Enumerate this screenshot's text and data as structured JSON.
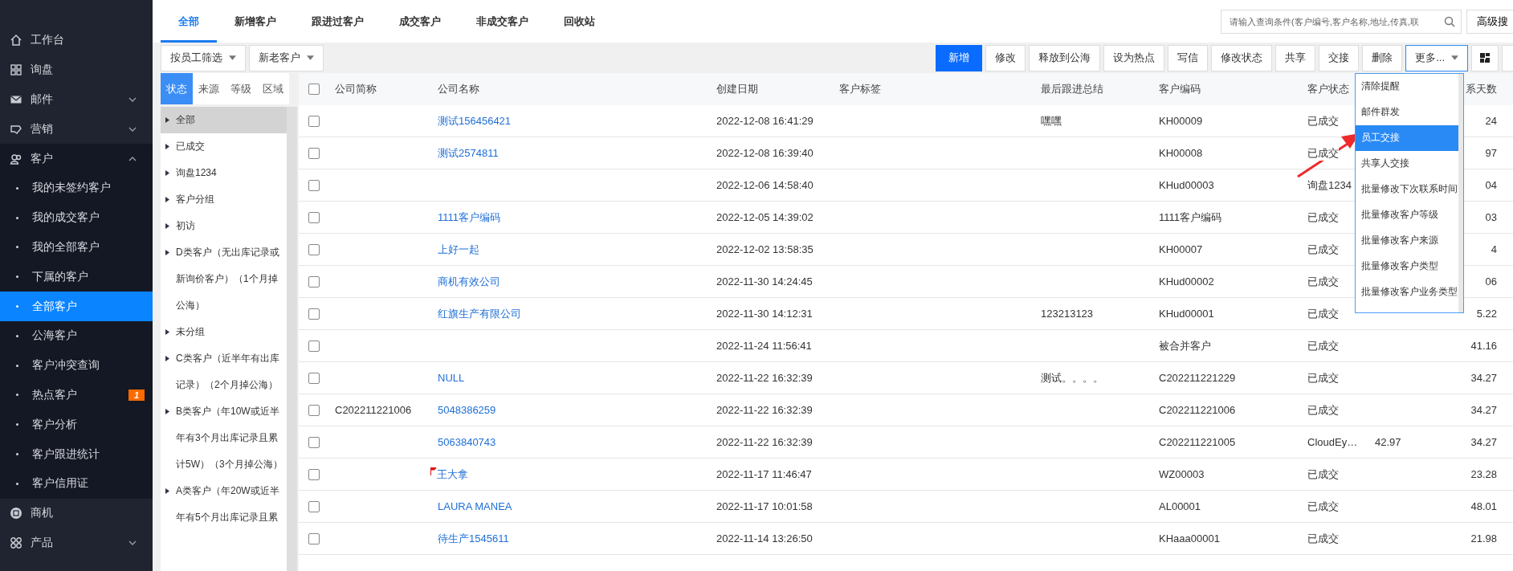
{
  "sidebar": {
    "items": [
      {
        "label": "工作台"
      },
      {
        "label": "询盘"
      },
      {
        "label": "邮件",
        "expanded": false
      },
      {
        "label": "营销",
        "expanded": false
      },
      {
        "label": "客户",
        "expanded": true,
        "children": [
          {
            "label": "我的未签约客户",
            "selected": false
          },
          {
            "label": "我的成交客户",
            "selected": false
          },
          {
            "label": "我的全部客户",
            "selected": false
          },
          {
            "label": "下属的客户",
            "selected": false
          },
          {
            "label": "全部客户",
            "selected": true
          },
          {
            "label": "公海客户",
            "selected": false
          },
          {
            "label": "客户冲突查询",
            "selected": false
          },
          {
            "label": "热点客户",
            "selected": false,
            "badge": "1"
          },
          {
            "label": "客户分析",
            "selected": false
          },
          {
            "label": "客户跟进统计",
            "selected": false
          },
          {
            "label": "客户信用证",
            "selected": false
          }
        ]
      },
      {
        "label": "商机"
      },
      {
        "label": "产品",
        "expanded": false
      }
    ]
  },
  "tabs": [
    {
      "label": "全部",
      "selected": true
    },
    {
      "label": "新增客户",
      "selected": false
    },
    {
      "label": "跟进过客户",
      "selected": false
    },
    {
      "label": "成交客户",
      "selected": false
    },
    {
      "label": "非成交客户",
      "selected": false
    },
    {
      "label": "回收站",
      "selected": false
    }
  ],
  "search": {
    "placeholder": "请输入查询条件(客户编号,客户名称,地址,传真,联"
  },
  "advanced_search": "高级搜",
  "filters": [
    "按员工筛选",
    "新老客户"
  ],
  "toolbar": [
    {
      "label": "新增",
      "kind": "primary"
    },
    {
      "label": "修改",
      "kind": "plain"
    },
    {
      "label": "释放到公海",
      "kind": "plain"
    },
    {
      "label": "设为热点",
      "kind": "plain"
    },
    {
      "label": "写信",
      "kind": "plain"
    },
    {
      "label": "修改状态",
      "kind": "plain"
    },
    {
      "label": "共享",
      "kind": "plain"
    },
    {
      "label": "交接",
      "kind": "plain"
    },
    {
      "label": "删除",
      "kind": "plain"
    },
    {
      "label": "更多...",
      "kind": "menu",
      "open": true
    }
  ],
  "more_menu": [
    {
      "label": "清除提醒",
      "selected": false
    },
    {
      "label": "邮件群发",
      "selected": false
    },
    {
      "label": "员工交接",
      "selected": true
    },
    {
      "label": "共享人交接",
      "selected": false
    },
    {
      "label": "批量修改下次联系时间",
      "selected": false
    },
    {
      "label": "批量修改客户等级",
      "selected": false
    },
    {
      "label": "批量修改客户来源",
      "selected": false
    },
    {
      "label": "批量修改客户类型",
      "selected": false
    },
    {
      "label": "批量修改客户业务类型",
      "selected": false
    }
  ],
  "filter_panel": {
    "tabs": [
      {
        "label": "状态",
        "selected": true
      },
      {
        "label": "来源",
        "selected": false
      },
      {
        "label": "等级",
        "selected": false
      },
      {
        "label": "区域",
        "selected": false
      }
    ],
    "items": [
      {
        "label": "全部",
        "selected": true
      },
      {
        "label": "已成交",
        "selected": false
      },
      {
        "label": "询盘1234",
        "selected": false
      },
      {
        "label": "客户分组",
        "selected": false
      },
      {
        "label": "初访",
        "selected": false
      },
      {
        "label": "D类客户（无出库记录或新询价客户）（1个月掉公海）",
        "selected": false
      },
      {
        "label": "未分组",
        "selected": false
      },
      {
        "label": "C类客户（近半年有出库记录）（2个月掉公海）",
        "selected": false
      },
      {
        "label": "B类客户（年10W或近半年有3个月出库记录且累计5W）（3个月掉公海）",
        "selected": false
      },
      {
        "label": "A类客户（年20W或近半年有5个月出库记录且累",
        "selected": false
      }
    ]
  },
  "table": {
    "all_checked": false,
    "columns": [
      "公司简称",
      "公司名称",
      "创建日期",
      "客户标签",
      "最后跟进总结",
      "客户编码",
      "客户状态",
      "系天数"
    ],
    "rows": [
      {
        "checked": false,
        "flagged": false,
        "company_name": "测试156456421",
        "created": "2022-12-08 16:41:29",
        "last_followup": "嘿嘿",
        "code": "KH00009",
        "status": "已成交",
        "column_9": "24"
      },
      {
        "checked": false,
        "flagged": false,
        "company_name": "测试2574811",
        "created": "2022-12-08 16:39:40",
        "code": "KH00008",
        "status": "已成交",
        "column_9": "97"
      },
      {
        "checked": false,
        "flagged": false,
        "created": "2022-12-06 14:58:40",
        "code": "KHud00003",
        "status": "询盘1234",
        "column_9": "04"
      },
      {
        "checked": false,
        "flagged": false,
        "company_name": "1111客户编码",
        "created": "2022-12-05 14:39:02",
        "code": "1111客户编码",
        "status": "已成交",
        "column_9": "03"
      },
      {
        "checked": false,
        "flagged": false,
        "company_name": "上好一起",
        "created": "2022-12-02 13:58:35",
        "code": "KH00007",
        "status": "已成交",
        "column_9": "4"
      },
      {
        "checked": false,
        "flagged": false,
        "company_name": "商机有效公司",
        "created": "2022-11-30 14:24:45",
        "code": "KHud00002",
        "status": "已成交",
        "column_9": "06"
      },
      {
        "checked": false,
        "flagged": false,
        "company_name": "红旗生产有限公司",
        "created": "2022-11-30 14:12:31",
        "last_followup": "123213123",
        "code": "KHud00001",
        "status": "已成交",
        "column_9": "5.22"
      },
      {
        "checked": false,
        "flagged": false,
        "created": "2022-11-24 11:56:41",
        "code": "被合并客户",
        "status": "已成交",
        "column_9": "41.16"
      },
      {
        "checked": false,
        "flagged": false,
        "company_name": "NULL",
        "created": "2022-11-22 16:32:39",
        "last_followup": "测试。。。。",
        "code": "C202211221229",
        "status": "已成交",
        "column_9": "34.27"
      },
      {
        "checked": false,
        "flagged": false,
        "short_name": "C202211221006",
        "company_name": "5048386259",
        "created": "2022-11-22 16:32:39",
        "code": "C202211221006",
        "status": "已成交",
        "column_9": "34.27"
      },
      {
        "checked": false,
        "flagged": false,
        "company_name": "5063840743",
        "created": "2022-11-22 16:32:39",
        "code": "C202211221005",
        "status": "CloudEy…",
        "column_8": "42.97",
        "column_9": "34.27"
      },
      {
        "checked": false,
        "flagged": true,
        "company_name": "王大拿",
        "created": "2022-11-17 11:46:47",
        "code": "WZ00003",
        "status": "已成交",
        "column_9": "23.28"
      },
      {
        "checked": false,
        "flagged": false,
        "company_name": "LAURA MANEA",
        "created": "2022-11-17 10:01:58",
        "code": "AL00001",
        "status": "已成交",
        "column_9": "48.01"
      },
      {
        "checked": false,
        "flagged": false,
        "company_name": "待生产1545611",
        "created": "2022-11-14 13:26:50",
        "code": "KHaaa00001",
        "status": "已成交",
        "column_9": "21.98"
      }
    ]
  }
}
